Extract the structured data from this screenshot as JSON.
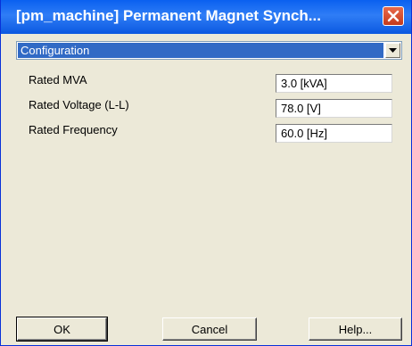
{
  "window": {
    "title": "[pm_machine] Permanent Magnet Synch..."
  },
  "section_select": {
    "value": "Configuration"
  },
  "fields": [
    {
      "label": "Rated MVA",
      "value": "3.0 [kVA]"
    },
    {
      "label": "Rated Voltage (L-L)",
      "value": "78.0 [V]"
    },
    {
      "label": "Rated Frequency",
      "value": "60.0 [Hz]"
    }
  ],
  "buttons": {
    "ok": "OK",
    "cancel": "Cancel",
    "help": "Help..."
  },
  "colors": {
    "titlebar": "#0a60f0",
    "selection": "#316ac5",
    "close": "#c43a1c",
    "dialog_bg": "#ece9d8"
  },
  "icons": {
    "close": "close-icon",
    "dropdown": "chevron-down-icon"
  }
}
